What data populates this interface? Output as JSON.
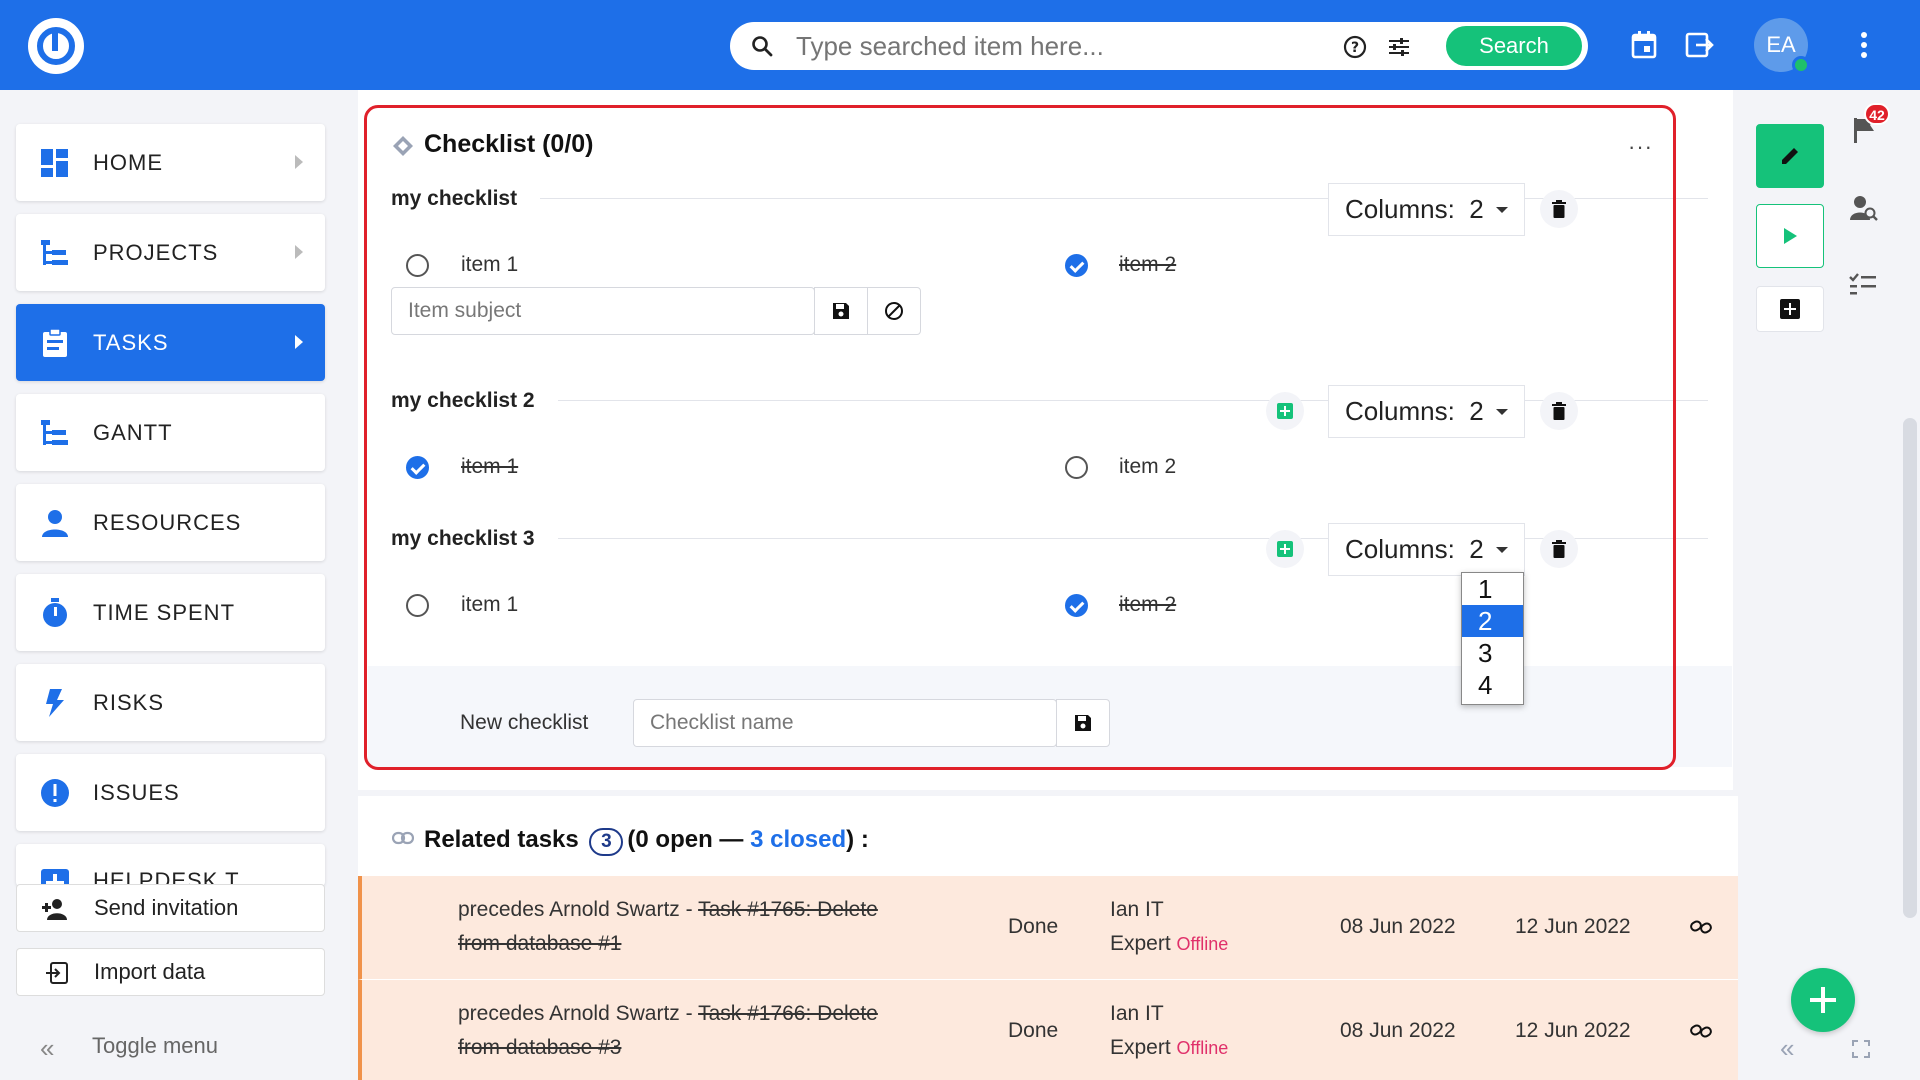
{
  "topbar": {
    "search_placeholder": "Type searched item here...",
    "search_button": "Search",
    "avatar_initials": "EA"
  },
  "sidebar": {
    "items": [
      {
        "label": "HOME",
        "icon": "dashboard-icon"
      },
      {
        "label": "PROJECTS",
        "icon": "projects-icon"
      },
      {
        "label": "TASKS",
        "icon": "clipboard-icon"
      },
      {
        "label": "GANTT",
        "icon": "gantt-icon"
      },
      {
        "label": "RESOURCES",
        "icon": "person-icon"
      },
      {
        "label": "TIME SPENT",
        "icon": "stopwatch-icon"
      },
      {
        "label": "RISKS",
        "icon": "lightning-icon"
      },
      {
        "label": "ISSUES",
        "icon": "exclamation-icon"
      },
      {
        "label": "HELPDESK T",
        "icon": "helpdesk-icon"
      }
    ],
    "send_invitation": "Send invitation",
    "import_data": "Import data",
    "toggle_menu": "Toggle menu"
  },
  "checklist": {
    "title": "Checklist (0/0)",
    "columns_label": "Columns:",
    "lists": [
      {
        "name": "my checklist",
        "columns": "2",
        "items": [
          {
            "label": "item 1",
            "done": false
          },
          {
            "label": "item 2",
            "done": true
          }
        ],
        "input_placeholder": "Item subject"
      },
      {
        "name": "my checklist 2",
        "columns": "2",
        "items": [
          {
            "label": "item 1",
            "done": true
          },
          {
            "label": "item 2",
            "done": false
          }
        ]
      },
      {
        "name": "my checklist 3",
        "columns": "2",
        "items": [
          {
            "label": "item 1",
            "done": false
          },
          {
            "label": "item 2",
            "done": true
          }
        ]
      }
    ],
    "dropdown_options": [
      "1",
      "2",
      "3",
      "4"
    ],
    "dropdown_selected": "2",
    "new_checklist_label": "New checklist",
    "new_checklist_placeholder": "Checklist name"
  },
  "related": {
    "title": "Related tasks",
    "count": "3",
    "open_text": "(0 open —",
    "closed_text": "3 closed",
    "tail": ") :",
    "rows": [
      {
        "prefix": "precedes Arnold Swartz - ",
        "task": "Task #1765: Delete",
        "task2": "from database #1",
        "status": "Done",
        "assignee1": "Ian IT",
        "assignee2": "Expert",
        "presence": "Offline",
        "start": "08 Jun 2022",
        "due": "12 Jun 2022"
      },
      {
        "prefix": "precedes Arnold Swartz - ",
        "task": "Task #1766: Delete",
        "task2": "from database #3",
        "status": "Done",
        "assignee1": "Ian IT",
        "assignee2": "Expert",
        "presence": "Offline",
        "start": "08 Jun 2022",
        "due": "12 Jun 2022"
      }
    ]
  },
  "rightbar": {
    "notification_count": "42"
  },
  "colors": {
    "brand_blue": "#1e6fe8",
    "accent_green": "#15c27a",
    "highlight_red": "#e0202a",
    "row_bg": "#fde9dd"
  }
}
